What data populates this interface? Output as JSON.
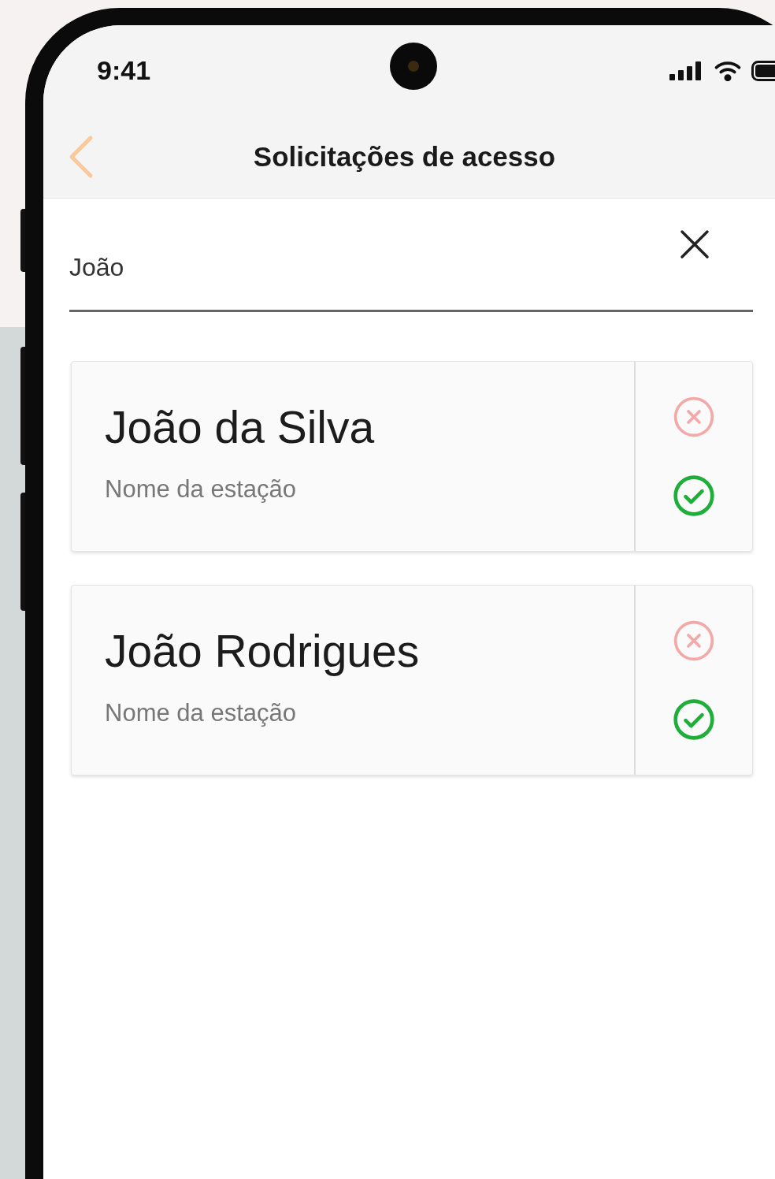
{
  "status_bar": {
    "time": "9:41"
  },
  "header": {
    "title": "Solicitações de acesso"
  },
  "search": {
    "value": "João"
  },
  "requests": [
    {
      "name": "João da Silva",
      "station": "Nome da estação"
    },
    {
      "name": "João Rodrigues",
      "station": "Nome da estação"
    }
  ]
}
